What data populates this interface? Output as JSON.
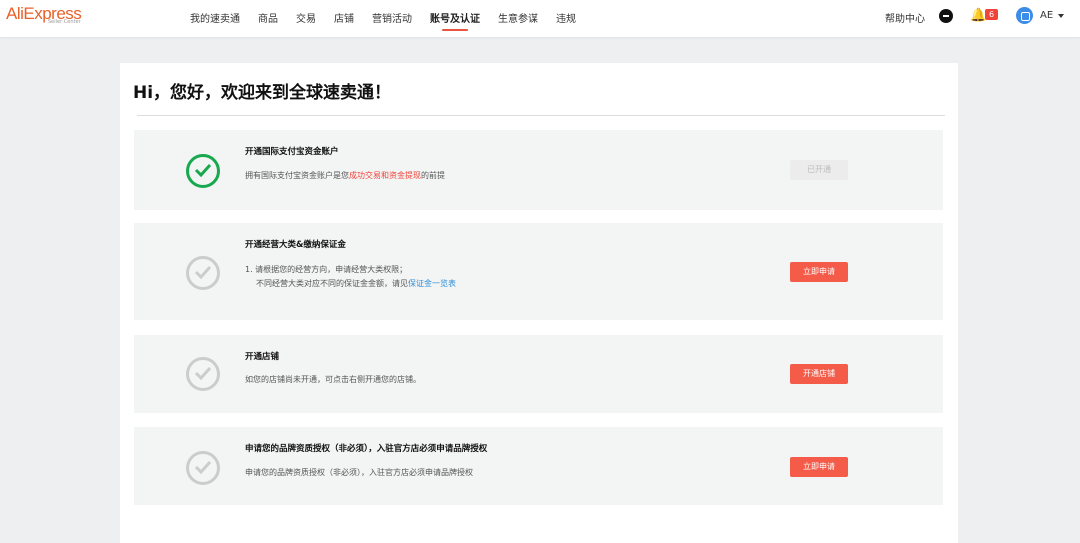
{
  "header": {
    "logo": "AliExpress",
    "logo_sub": "Seller Center",
    "nav": [
      "我的速卖通",
      "商品",
      "交易",
      "店铺",
      "营销活动",
      "账号及认证",
      "生意参谋",
      "违规"
    ],
    "active_nav": "账号及认证",
    "help": "帮助中心",
    "notification_count": "6",
    "user": "AE"
  },
  "main": {
    "title": "Hi，您好，欢迎来到全球速卖通！",
    "steps": [
      {
        "title": "开通国际支付宝资金账户",
        "desc_pre": "拥有国际支付宝资金账户是您",
        "desc_highlight": "成功交易和资金提现",
        "desc_post": "的前提",
        "button": "已开通",
        "status": "done"
      },
      {
        "title": "开通经营大类&缴纳保证金",
        "desc_line1": "1. 请根据您的经营方向，申请经营大类权限；",
        "desc_line2_pre": "不同经营大类对应不同的保证金金额，请见",
        "desc_link": "保证金一览表",
        "button": "立即申请",
        "status": "pending"
      },
      {
        "title": "开通店铺",
        "desc": "如您的店铺尚未开通，可点击右侧开通您的店铺。",
        "button": "开通店铺",
        "status": "pending"
      },
      {
        "title": "申请您的品牌资质授权（非必须），入驻官方店必须申请品牌授权",
        "desc": "申请您的品牌资质授权（非必须），入驻官方店必须申请品牌授权",
        "button": "立即申请",
        "status": "pending"
      }
    ]
  },
  "colors": {
    "accent": "#f45b48",
    "done": "#18a84e",
    "link": "#2f8ed6"
  }
}
